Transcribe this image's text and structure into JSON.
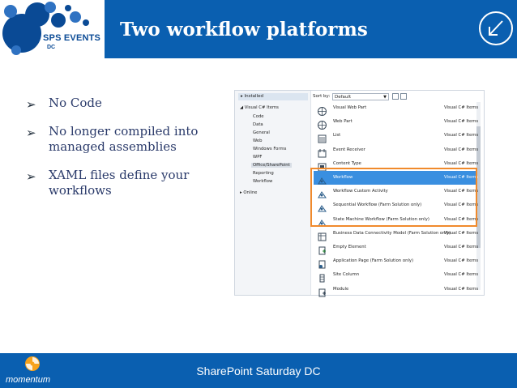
{
  "header": {
    "title": "Two workflow platforms",
    "logo": {
      "name": "SPS EVENTS",
      "sub": "DC"
    },
    "corner_icon": "arrow-down-left-circle-icon"
  },
  "bullets": [
    {
      "text": "No Code"
    },
    {
      "text": "No longer compiled into managed assemblies"
    },
    {
      "text": "XAML files define your workflows"
    }
  ],
  "vs_dialog": {
    "installed_label": "Installed",
    "tree": {
      "root": "Visual C# Items",
      "children": [
        "Code",
        "Data",
        "General",
        "Web",
        "Windows Forms",
        "WPF",
        "Office/SharePoint",
        "Reporting",
        "Workflow"
      ],
      "selected": "Office/SharePoint",
      "online": "Online"
    },
    "sort_label": "Sort by:",
    "sort_value": "Default",
    "templates": [
      {
        "name": "Visual Web Part",
        "type": "Visual C# Items",
        "icon": "globe-webpart-icon"
      },
      {
        "name": "Web Part",
        "type": "Visual C# Items",
        "icon": "globe-icon"
      },
      {
        "name": "List",
        "type": "Visual C# Items",
        "icon": "list-icon"
      },
      {
        "name": "Event Receiver",
        "type": "Visual C# Items",
        "icon": "event-receiver-icon"
      },
      {
        "name": "Content Type",
        "type": "Visual C# Items",
        "icon": "content-type-icon"
      },
      {
        "name": "Workflow",
        "type": "Visual C# Items",
        "icon": "workflow-icon"
      },
      {
        "name": "Workflow Custom Activity",
        "type": "Visual C# Items",
        "icon": "workflow-activity-icon"
      },
      {
        "name": "Sequential Workflow (Farm Solution only)",
        "type": "Visual C# Items",
        "icon": "sequential-workflow-icon"
      },
      {
        "name": "State Machine Workflow (Farm Solution only)",
        "type": "Visual C# Items",
        "icon": "state-machine-workflow-icon"
      },
      {
        "name": "Business Data Connectivity Model (Farm Solution only)",
        "type": "Visual C# Items",
        "icon": "bdc-model-icon"
      },
      {
        "name": "Empty Element",
        "type": "Visual C# Items",
        "icon": "empty-element-icon"
      },
      {
        "name": "Application Page (Farm Solution only)",
        "type": "Visual C# Items",
        "icon": "application-page-icon"
      },
      {
        "name": "Site Column",
        "type": "Visual C# Items",
        "icon": "site-column-icon"
      },
      {
        "name": "Module",
        "type": "Visual C# Items",
        "icon": "module-icon"
      }
    ],
    "selected_template": "Workflow",
    "highlight_color": "#f08a2c",
    "selection_color": "#3a8fe0"
  },
  "footer": {
    "text": "SharePoint Saturday DC",
    "brand": "momentum"
  },
  "colors": {
    "header_bg": "#0a5fb0",
    "title_text": "#ffffff",
    "bullet_text": "#2a3a6a"
  }
}
